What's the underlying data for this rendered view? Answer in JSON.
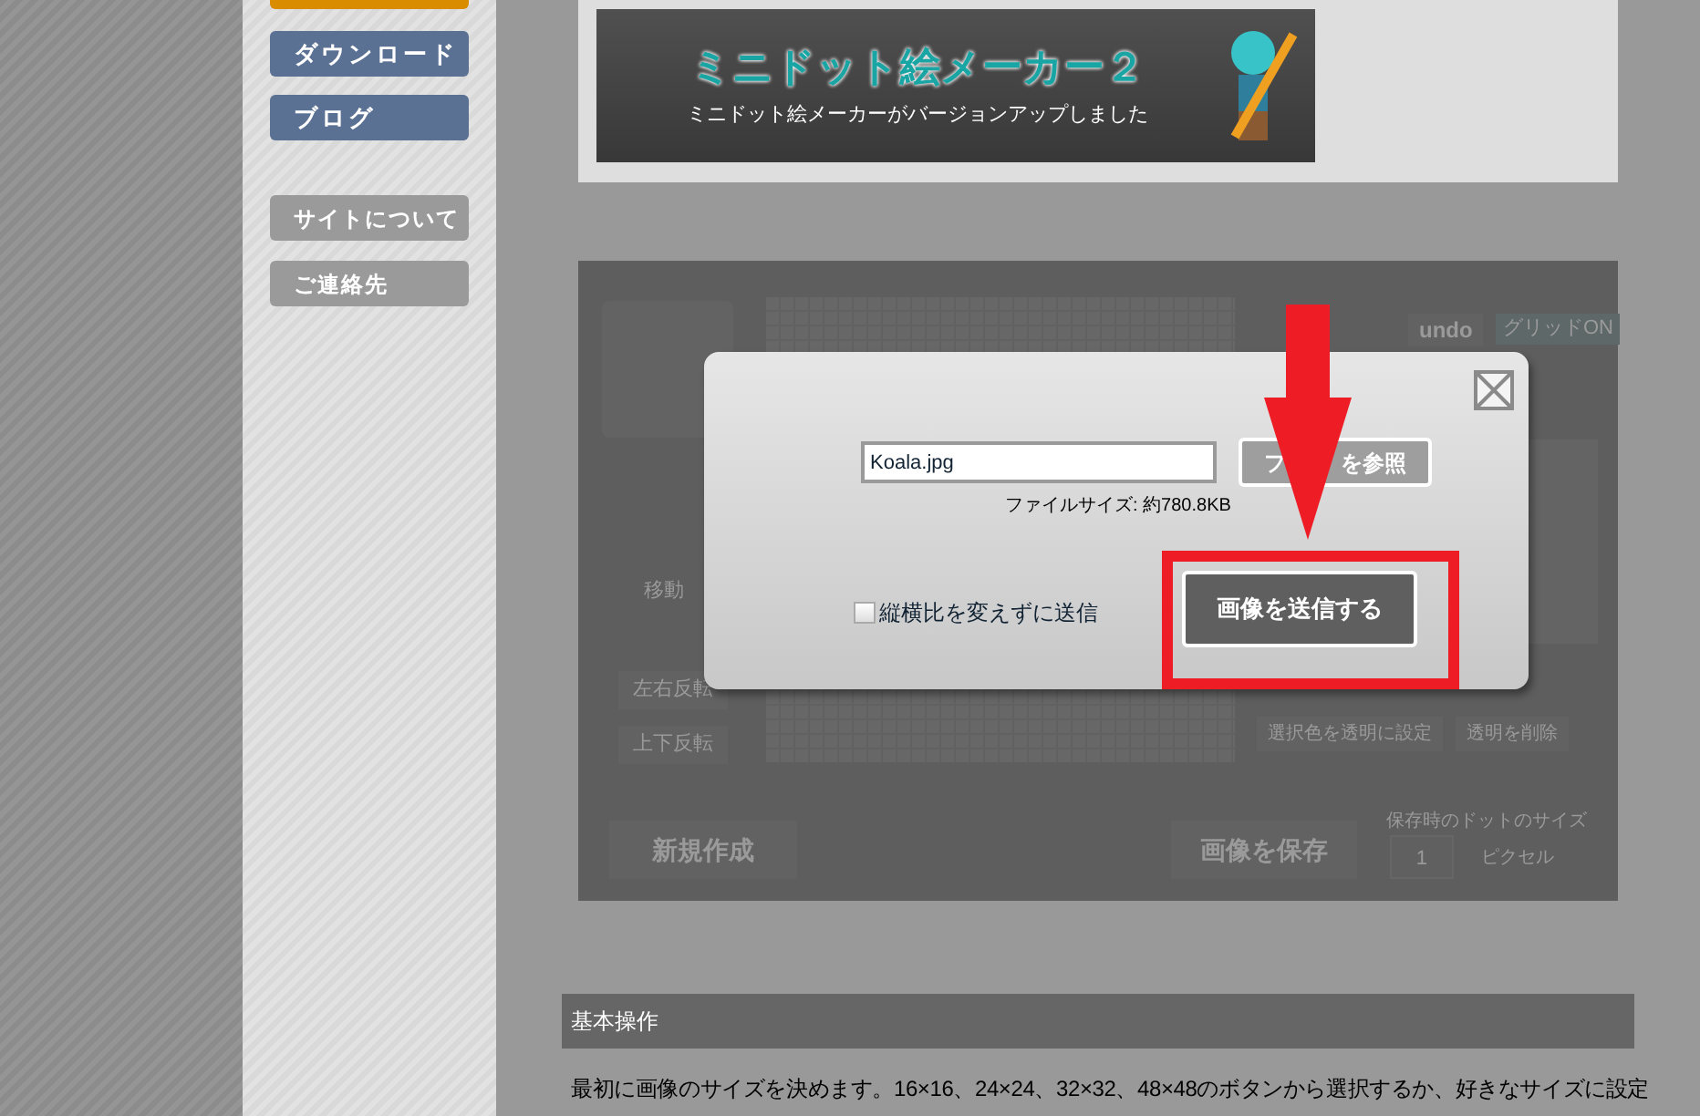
{
  "sidebar": {
    "items": [
      {
        "kind": "accent"
      },
      {
        "label": "ダウンロード",
        "kind": "blue"
      },
      {
        "label": "ブログ",
        "kind": "blue"
      },
      {
        "label": "サイトについて",
        "kind": "gray"
      },
      {
        "label": "ご連絡先",
        "kind": "gray"
      }
    ]
  },
  "banner": {
    "title": "ミニドット絵メーカー２",
    "subtitle": "ミニドット絵メーカーがバージョンアップしました"
  },
  "editor": {
    "move_label": "移動",
    "flip_horizontal": "左右反転",
    "flip_vertical": "上下反転",
    "undo": "undo",
    "grid_toggle": "グリッドON",
    "set_transparent": "選択色を透明に設定",
    "clear_transparent": "透明を削除",
    "new_button": "新規作成",
    "save_button": "画像を保存",
    "dot_size_label": "保存時のドットのサイズ",
    "dot_size_value": "1",
    "dot_size_unit": "ピクセル"
  },
  "dialog": {
    "file_name": "Koala.jpg",
    "browse_button": [
      "フ",
      "を参照"
    ],
    "file_size": "ファイルサイズ: 約780.8KB",
    "keep_ratio": {
      "label": "縦横比を変えずに送信",
      "checked": false
    },
    "send_button": "画像を送信する"
  },
  "section": {
    "heading": "基本操作",
    "text": "最初に画像のサイズを決めます。16×16、24×24、32×32、48×48のボタンから選択するか、好きなサイズに設定"
  }
}
